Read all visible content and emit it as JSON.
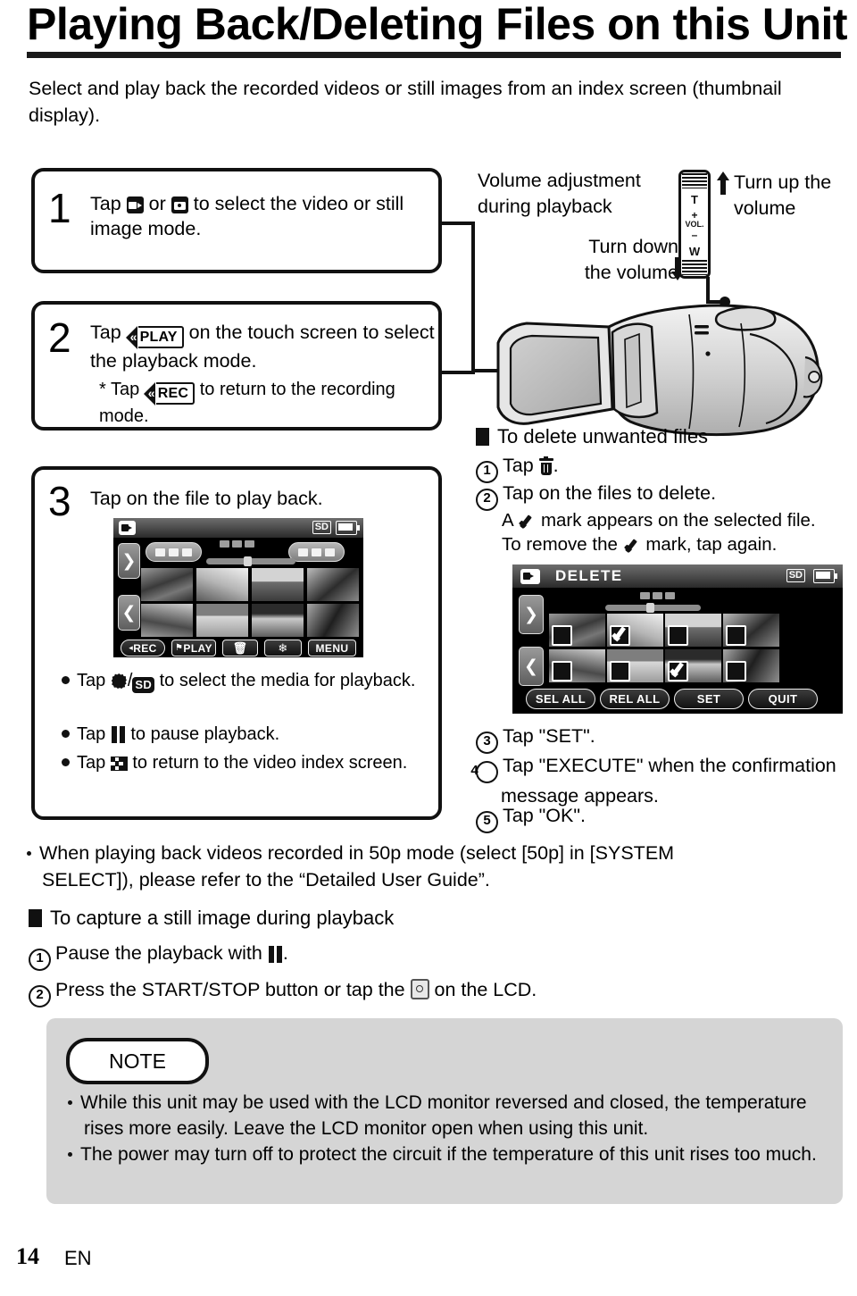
{
  "page": {
    "title": "Playing Back/Deleting Files on this Unit",
    "intro": "Select and play back the recorded videos or still images from an index screen (thumbnail display).",
    "footer_number": "14",
    "footer_lang": "EN"
  },
  "steps": [
    {
      "number": "1",
      "pre": "Tap",
      "mid": "or",
      "post": "to select the video or still image mode.",
      "icons": [
        "video-mode-icon",
        "still-image-mode-icon"
      ]
    },
    {
      "number": "2",
      "pre": "Tap",
      "badge": "PLAY",
      "post": "on the touch screen to select the playback mode.",
      "note_pre": "* Tap",
      "note_badge": "REC",
      "note_post": "to return to the recording mode."
    },
    {
      "number": "3",
      "text": "Tap on the file to play back."
    }
  ],
  "step3_bullets": [
    {
      "pre": "Tap",
      "icons": "built-in-memory / SD",
      "post": "to select the media for playback."
    },
    {
      "pre": "Tap",
      "icons": "pause",
      "post": "to pause playback."
    },
    {
      "pre": "Tap",
      "icons": "index",
      "post": "to return to the video index screen."
    }
  ],
  "volume": {
    "heading_line1": "Volume adjustment",
    "heading_line2": "during playback",
    "turn_up_line1": "Turn up the",
    "turn_up_line2": "volume",
    "turn_down_line1": "Turn down",
    "turn_down_line2": "the volume",
    "lever_labels": {
      "tele": "T",
      "plus": "+",
      "vol": "VOL.",
      "minus": "–",
      "wide": "W"
    }
  },
  "delete_section": {
    "heading": "To delete unwanted files",
    "items": [
      {
        "num": "1",
        "pre": "Tap",
        "icon": "trash-icon",
        "post": "."
      },
      {
        "num": "2",
        "text": "Tap on the files to delete."
      }
    ],
    "note_line1_pre": "A",
    "note_line1_post": "mark appears on the selected file.",
    "note_line2_pre": "To remove the",
    "note_line2_post": "mark, tap again.",
    "items_after": [
      {
        "num": "3",
        "text": "Tap \"SET\"."
      },
      {
        "num": "4",
        "text": "Tap \"EXECUTE\" when the confirmation message appears."
      },
      {
        "num": "5",
        "text": "Tap \"OK\"."
      }
    ]
  },
  "index_screen": {
    "mode_icon": "video-mode-icon",
    "sd_label": "SD",
    "battery": "battery-icon",
    "nav_next": "❯",
    "nav_prev": "❮",
    "toolbar": [
      {
        "label": "REC",
        "name": "rec-button"
      },
      {
        "label": "PLAY",
        "name": "play-button"
      },
      {
        "label": "",
        "name": "delete-button"
      },
      {
        "label": "",
        "name": "media-select-button"
      },
      {
        "label": "MENU",
        "name": "menu-button"
      }
    ]
  },
  "delete_screen": {
    "title": "DELETE",
    "mode_icon": "video-mode-icon",
    "sd_label": "SD",
    "battery": "battery-icon",
    "nav_next": "❯",
    "nav_prev": "❮",
    "checked_thumbs": [
      1,
      6
    ],
    "buttons": [
      {
        "label": "SEL ALL",
        "name": "sel-all-button"
      },
      {
        "label": "REL ALL",
        "name": "rel-all-button"
      },
      {
        "label": "SET",
        "name": "set-button"
      },
      {
        "label": "QUIT",
        "name": "quit-button"
      }
    ]
  },
  "notes_50p": {
    "line1": "When playing back videos recorded in 50p mode (select [50p] in [SYSTEM",
    "line2": "SELECT]), please refer to the “Detailed User Guide”."
  },
  "capture_section": {
    "heading": "To capture a still image during playback",
    "item1_num": "1",
    "item1_pre": "Pause the playback with",
    "item1_post": ".",
    "item2_num": "2",
    "item2_pre": "Press the START/STOP button or tap the",
    "item2_post": "on the LCD."
  },
  "note_panel": {
    "label": "NOTE",
    "bullets": [
      "While this unit may be used with the LCD monitor reversed and closed, the temperature rises more easily. Leave the LCD monitor open when using this unit.",
      "The power may turn off to protect the circuit if the temperature of this unit rises too much."
    ]
  }
}
